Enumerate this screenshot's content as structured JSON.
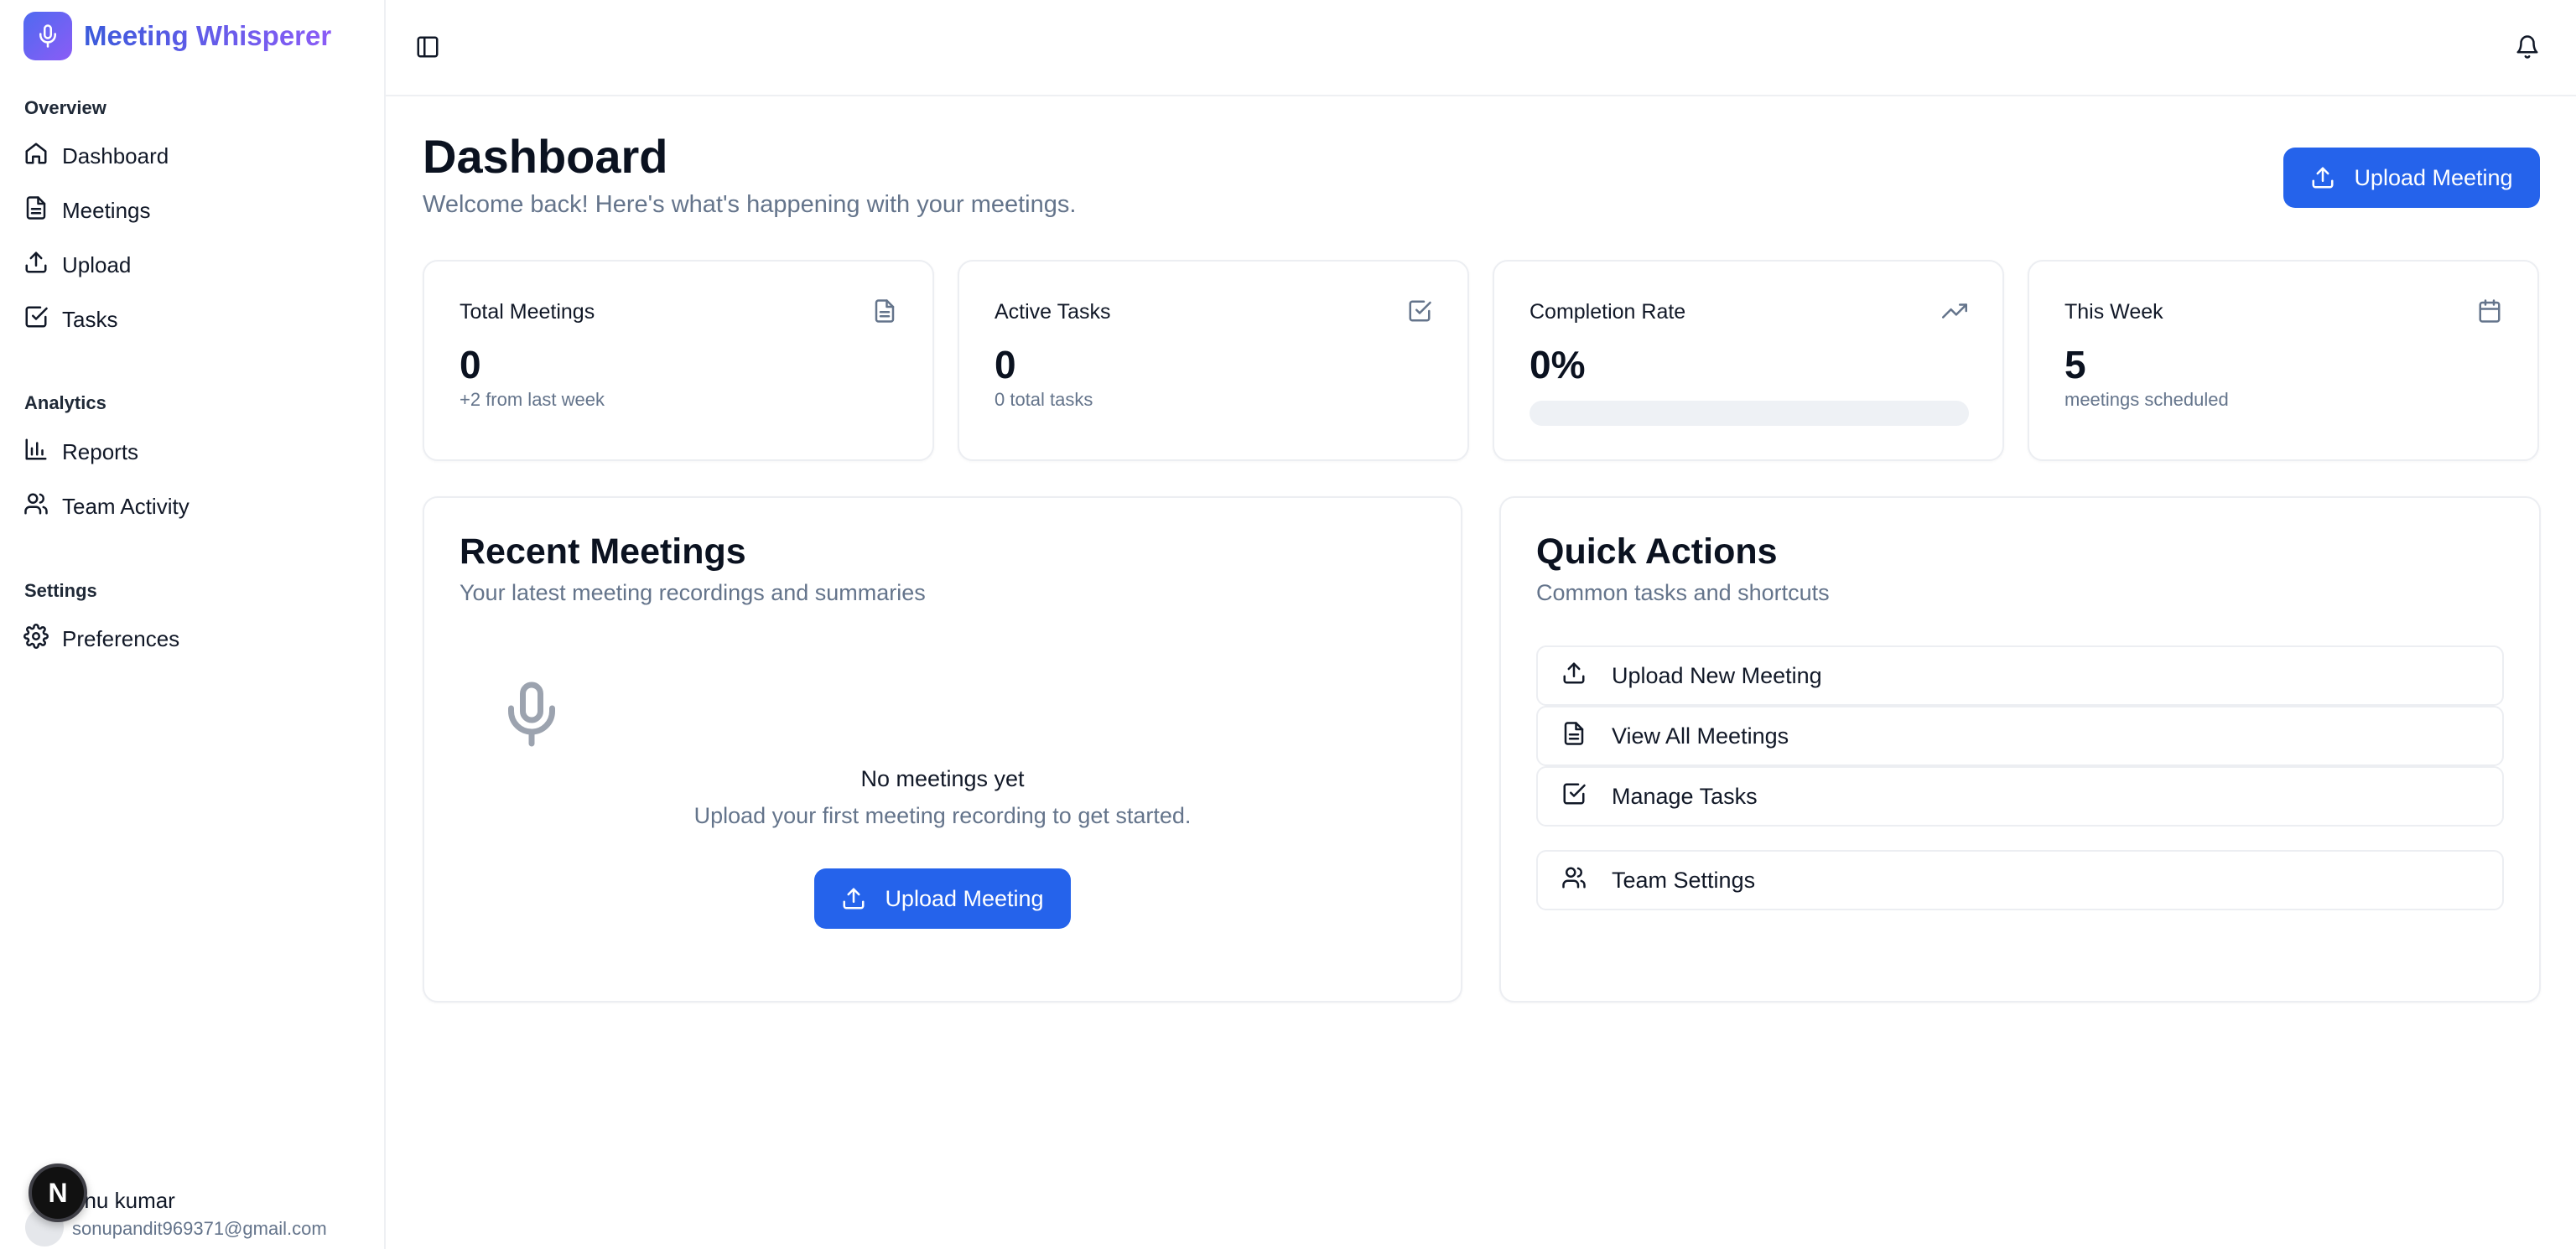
{
  "brand": {
    "title": "Meeting Whisperer",
    "logo_icon": "mic-icon"
  },
  "sidebar": {
    "groups": [
      {
        "label": "Overview",
        "items": [
          {
            "label": "Dashboard",
            "icon": "home-icon"
          },
          {
            "label": "Meetings",
            "icon": "file-text-icon"
          },
          {
            "label": "Upload",
            "icon": "upload-icon"
          },
          {
            "label": "Tasks",
            "icon": "check-square-icon"
          }
        ]
      },
      {
        "label": "Analytics",
        "items": [
          {
            "label": "Reports",
            "icon": "bar-chart-icon"
          },
          {
            "label": "Team Activity",
            "icon": "users-icon"
          }
        ]
      },
      {
        "label": "Settings",
        "items": [
          {
            "label": "Preferences",
            "icon": "gear-icon"
          }
        ]
      }
    ],
    "user": {
      "name": "onu kumar",
      "email": "sonupandit969371@gmail.com"
    },
    "dev_badge": "N"
  },
  "header": {
    "title": "Dashboard",
    "subtitle": "Welcome back! Here's what's happening with your meetings.",
    "upload_label": "Upload Meeting"
  },
  "stats": [
    {
      "label": "Total Meetings",
      "value": "0",
      "sub": "+2 from last week",
      "icon": "file-text-icon"
    },
    {
      "label": "Active Tasks",
      "value": "0",
      "sub": "0 total tasks",
      "icon": "check-square-icon"
    },
    {
      "label": "Completion Rate",
      "value": "0%",
      "progress": 0,
      "icon": "trending-up-icon"
    },
    {
      "label": "This Week",
      "value": "5",
      "sub": "meetings scheduled",
      "icon": "calendar-icon"
    }
  ],
  "recent": {
    "title": "Recent Meetings",
    "subtitle": "Your latest meeting recordings and summaries",
    "empty_title": "No meetings yet",
    "empty_sub": "Upload your first meeting recording to get started.",
    "upload_label": "Upload Meeting"
  },
  "quick": {
    "title": "Quick Actions",
    "subtitle": "Common tasks and shortcuts",
    "items": [
      {
        "label": "Upload New Meeting",
        "icon": "upload-icon"
      },
      {
        "label": "View All Meetings",
        "icon": "file-text-icon"
      },
      {
        "label": "Manage Tasks",
        "icon": "check-square-icon"
      },
      {
        "label": "Team Settings",
        "icon": "users-icon"
      }
    ]
  },
  "colors": {
    "primary": "#2563eb",
    "muted_text": "#64748b",
    "border": "#eceef2"
  }
}
